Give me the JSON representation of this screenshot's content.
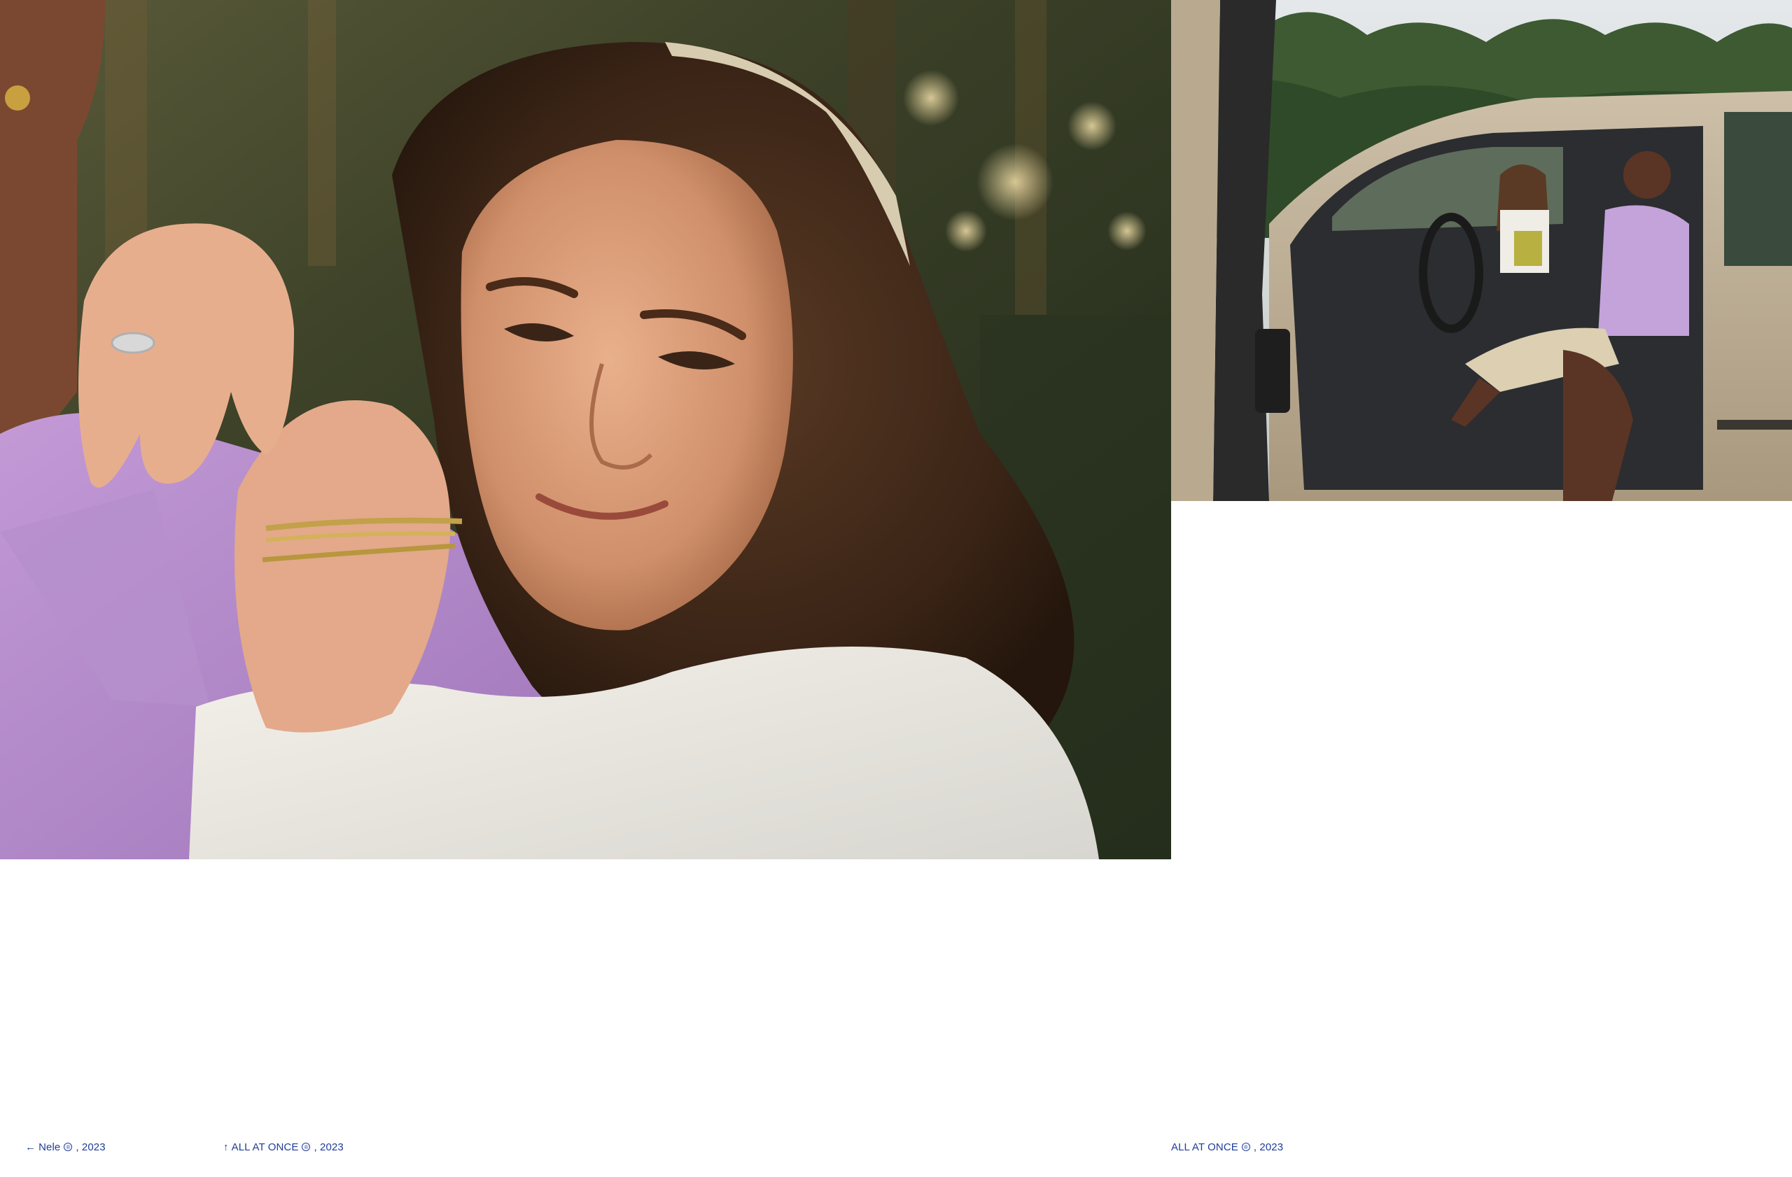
{
  "photos": [
    {
      "name": "portrait-woman-headband"
    },
    {
      "name": "couple-in-car"
    }
  ],
  "captions": {
    "prev": {
      "arrow": "←",
      "label": "Nele",
      "mark": "®",
      "year": ", 2023"
    },
    "up": {
      "arrow": "↑",
      "label": "ALL AT ONCE",
      "mark": "®",
      "year": ", 2023"
    },
    "current": {
      "label": "ALL AT ONCE",
      "mark": "®",
      "year": ", 2023"
    }
  },
  "colors": {
    "link": "#1f3d99",
    "background": "#ffffff"
  }
}
